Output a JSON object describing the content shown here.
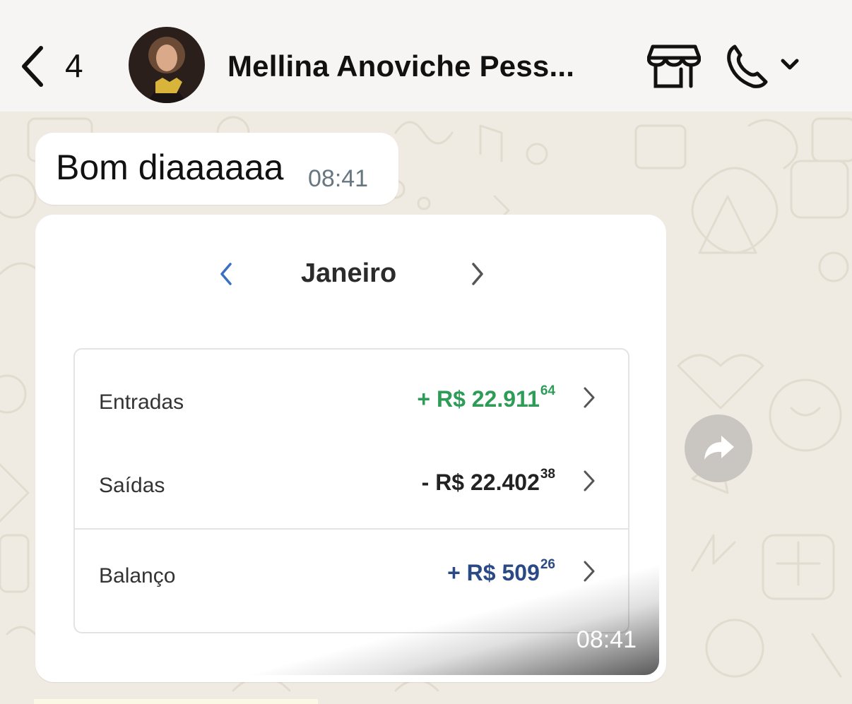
{
  "header": {
    "back_count": "4",
    "contact_name": "Mellina Anoviche Pess..."
  },
  "icons": {
    "back": "chevron-left-icon",
    "store": "storefront-icon",
    "call": "phone-icon",
    "forward": "forward-arrow-icon"
  },
  "messages": [
    {
      "text": "Bom diaaaaaa",
      "time": "08:41"
    },
    {
      "time": "08:41",
      "image": {
        "month": "Janeiro",
        "rows": [
          {
            "label": "Entradas",
            "sign": "+",
            "amount": "R$ 22.911",
            "cents": "64",
            "color": "#2e9c57"
          },
          {
            "label": "Saídas",
            "sign": "-",
            "amount": "R$ 22.402",
            "cents": "38",
            "color": "#222222"
          },
          {
            "label": "Balanço",
            "sign": "+",
            "amount": "R$ 509",
            "cents": "26",
            "color": "#2a4a86"
          }
        ]
      }
    }
  ],
  "colors": {
    "chat_background": "#efeae2",
    "header_background": "#f6f5f3",
    "accent_blue": "#3a6fc4"
  }
}
